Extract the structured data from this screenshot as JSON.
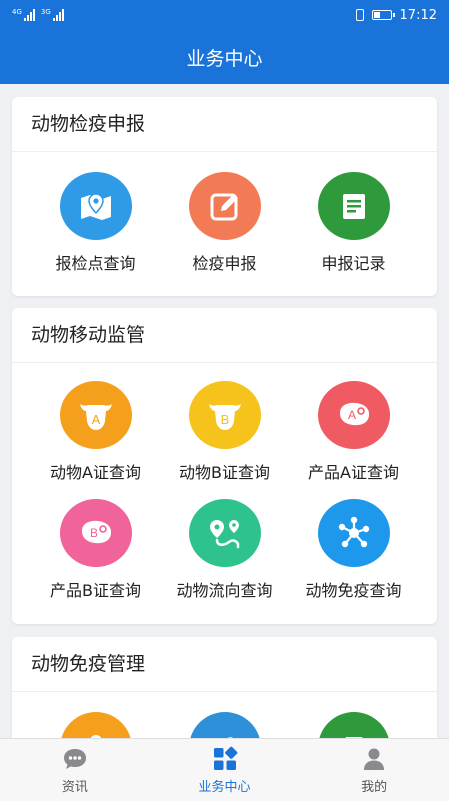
{
  "status_bar": {
    "sim1": "4G",
    "sim2": "3G",
    "time": "17:12"
  },
  "header": {
    "title": "业务中心"
  },
  "sections": [
    {
      "title": "动物检疫申报",
      "items": [
        {
          "label": "报检点查询",
          "icon": "map-pin-icon",
          "color": "#2f9be6"
        },
        {
          "label": "检疫申报",
          "icon": "edit-icon",
          "color": "#f27a55"
        },
        {
          "label": "申报记录",
          "icon": "document-icon",
          "color": "#2e9a3c"
        }
      ]
    },
    {
      "title": "动物移动监管",
      "items": [
        {
          "label": "动物A证查询",
          "icon": "cow-a-icon",
          "glyph": "A",
          "color": "#f5a01c"
        },
        {
          "label": "动物B证查询",
          "icon": "cow-b-icon",
          "glyph": "B",
          "color": "#f5c31c"
        },
        {
          "label": "产品A证查询",
          "icon": "meat-a-icon",
          "glyph": "A",
          "color": "#ef5a63"
        },
        {
          "label": "产品B证查询",
          "icon": "meat-b-icon",
          "glyph": "B",
          "color": "#f0639b"
        },
        {
          "label": "动物流向查询",
          "icon": "route-icon",
          "color": "#2ec28d"
        },
        {
          "label": "动物免疫查询",
          "icon": "molecule-icon",
          "color": "#1d98ea"
        }
      ]
    },
    {
      "title": "动物免疫管理",
      "items": [
        {
          "label": "",
          "icon": "partial-icon-orange",
          "color": "#f5a01c"
        },
        {
          "label": "",
          "icon": "partial-icon-blue",
          "color": "#2d90d8"
        },
        {
          "label": "",
          "icon": "partial-icon-green",
          "color": "#2e9a3c"
        }
      ]
    }
  ],
  "tabbar": {
    "tabs": [
      {
        "label": "资讯",
        "icon": "chat-bubble-icon",
        "active": false
      },
      {
        "label": "业务中心",
        "icon": "grid-apps-icon",
        "active": true
      },
      {
        "label": "我的",
        "icon": "user-icon",
        "active": false
      }
    ]
  },
  "colors": {
    "primary": "#1a73d8",
    "background": "#eef0f4"
  }
}
